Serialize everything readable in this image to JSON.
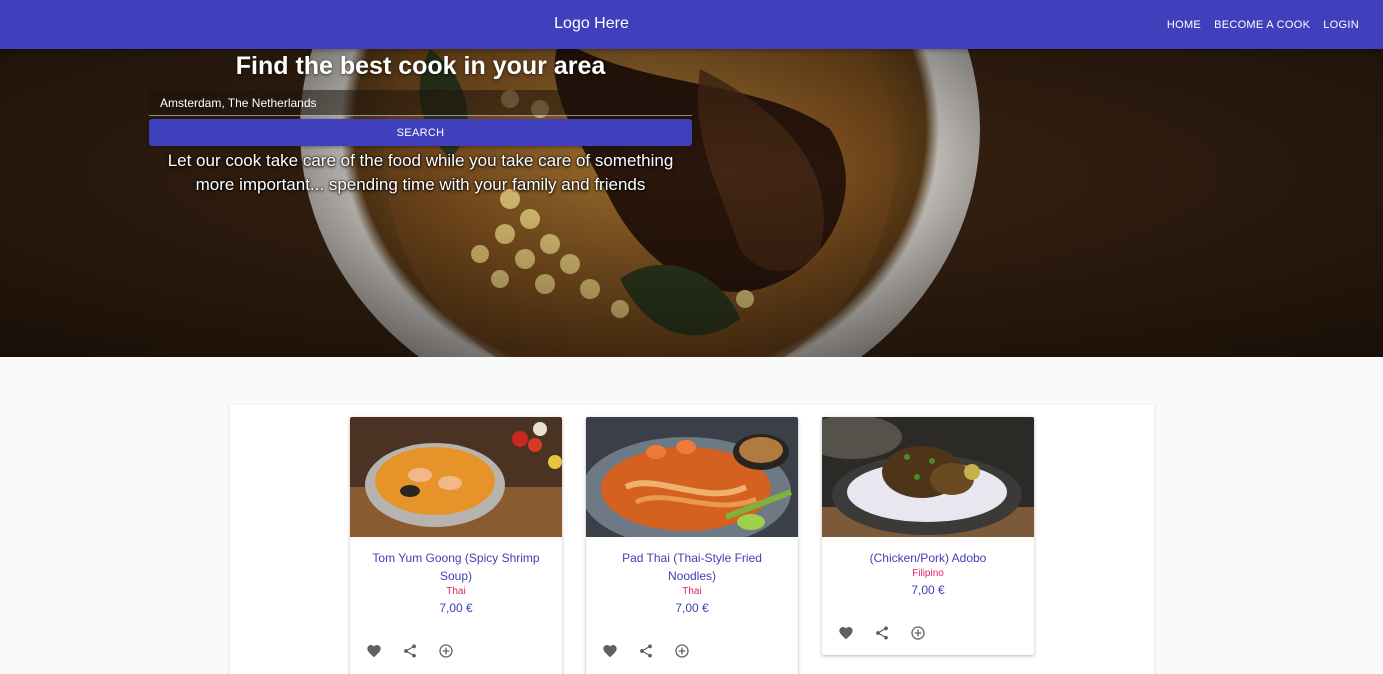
{
  "navbar": {
    "logo": "Logo Here",
    "links": [
      {
        "label": "HOME"
      },
      {
        "label": "BECOME A COOK"
      },
      {
        "label": "LOGIN"
      }
    ]
  },
  "hero": {
    "title": "Find the best cook in your area",
    "location_value": "Amsterdam, The Netherlands",
    "search_label": "SEARCH",
    "tagline": "Let our cook take care of the food while you take care of something more important... spending time with your family and friends"
  },
  "dishes": [
    {
      "name": "Tom Yum Goong (Spicy Shrimp Soup)",
      "cuisine": "Thai",
      "price": "7,00 €"
    },
    {
      "name": "Pad Thai (Thai-Style Fried Noodles)",
      "cuisine": "Thai",
      "price": "7,00 €"
    },
    {
      "name": "(Chicken/Pork) Adobo",
      "cuisine": "Filipino",
      "price": "7,00 €"
    }
  ],
  "icons": {
    "favorite": "heart-icon",
    "share": "share-icon",
    "add": "add-circle-icon"
  },
  "colors": {
    "primary": "#4040bd",
    "accent": "#e91e63",
    "action_icon": "#616161"
  }
}
